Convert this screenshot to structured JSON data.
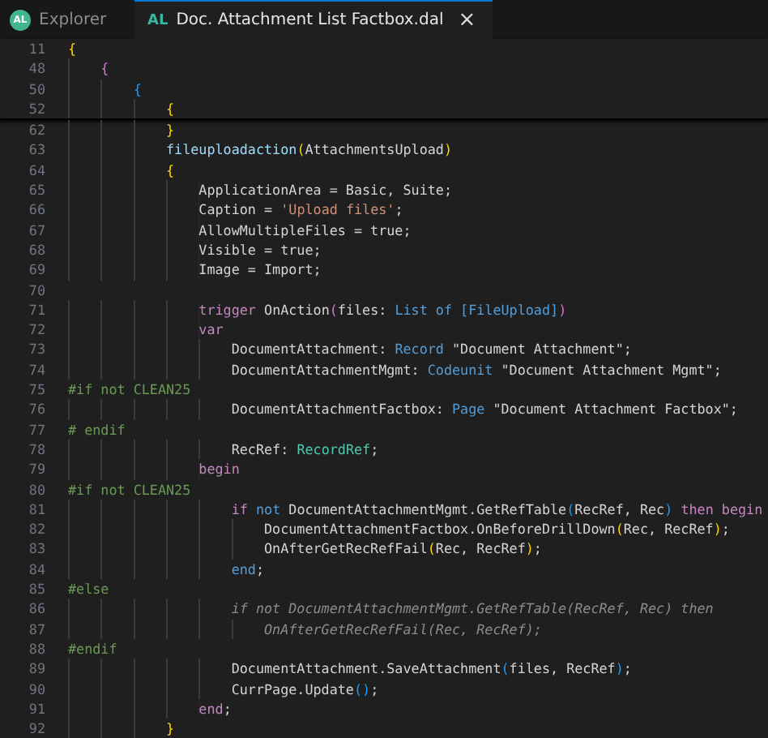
{
  "tabs": [
    {
      "label": "Explorer",
      "badge": "AL",
      "kind": "avatar",
      "selected": false,
      "closable": false
    },
    {
      "label": "Doc. Attachment List Factbox.dal",
      "badge": "AL",
      "kind": "file",
      "selected": true,
      "closable": true,
      "close_glyph": "×"
    }
  ],
  "sticky_lines": [
    {
      "number": "11",
      "tokens": [
        {
          "text": "{",
          "kind": "b1"
        }
      ]
    },
    {
      "number": "48",
      "tokens": [
        {
          "text": "    {",
          "kind": "b2"
        }
      ]
    },
    {
      "number": "50",
      "tokens": [
        {
          "text": "        {",
          "kind": "b3"
        }
      ]
    },
    {
      "number": "52",
      "tokens": [
        {
          "text": "            {",
          "kind": "b1"
        }
      ]
    }
  ],
  "lines": [
    {
      "number": "62",
      "tokens": [
        {
          "text": "            }",
          "kind": "b1"
        }
      ]
    },
    {
      "number": "63",
      "tokens": [
        {
          "text": "            fileuploadaction",
          "kind": "fn"
        },
        {
          "text": "(",
          "kind": "b1"
        },
        {
          "text": "AttachmentsUpload",
          "kind": "plain"
        },
        {
          "text": ")",
          "kind": "b1"
        }
      ]
    },
    {
      "number": "64",
      "tokens": [
        {
          "text": "            {",
          "kind": "b1"
        }
      ]
    },
    {
      "number": "65",
      "tokens": [
        {
          "text": "                ApplicationArea = Basic, Suite;",
          "kind": "plain"
        }
      ]
    },
    {
      "number": "66",
      "tokens": [
        {
          "text": "                Caption = ",
          "kind": "plain"
        },
        {
          "text": "'Upload files'",
          "kind": "string"
        },
        {
          "text": ";",
          "kind": "plain"
        }
      ]
    },
    {
      "number": "67",
      "tokens": [
        {
          "text": "                AllowMultipleFiles = true;",
          "kind": "plain"
        }
      ]
    },
    {
      "number": "68",
      "tokens": [
        {
          "text": "                Visible = true;",
          "kind": "plain"
        }
      ]
    },
    {
      "number": "69",
      "tokens": [
        {
          "text": "                Image = Import;",
          "kind": "plain"
        }
      ]
    },
    {
      "number": "70"
    },
    {
      "number": "71",
      "tokens": [
        {
          "text": "                trigger",
          "kind": "control"
        },
        {
          "text": " OnAction",
          "kind": "plain"
        },
        {
          "text": "(",
          "kind": "b2"
        },
        {
          "text": "files: ",
          "kind": "plain"
        },
        {
          "text": "List of [FileUpload]",
          "kind": "type"
        },
        {
          "text": ")",
          "kind": "b2"
        }
      ]
    },
    {
      "number": "72",
      "tokens": [
        {
          "text": "                var",
          "kind": "control"
        }
      ]
    },
    {
      "number": "73",
      "tokens": [
        {
          "text": "                    DocumentAttachment: ",
          "kind": "plain"
        },
        {
          "text": "Record",
          "kind": "type"
        },
        {
          "text": " \"Document Attachment\";",
          "kind": "plain"
        }
      ]
    },
    {
      "number": "74",
      "tokens": [
        {
          "text": "                    DocumentAttachmentMgmt: ",
          "kind": "plain"
        },
        {
          "text": "Codeunit",
          "kind": "type"
        },
        {
          "text": " \"Document Attachment Mgmt\";",
          "kind": "plain"
        }
      ]
    },
    {
      "number": "75",
      "tokens": [
        {
          "text": "#if not CLEAN25",
          "kind": "directive"
        }
      ]
    },
    {
      "number": "76",
      "tokens": [
        {
          "text": "                    DocumentAttachmentFactbox: ",
          "kind": "plain"
        },
        {
          "text": "Page",
          "kind": "type"
        },
        {
          "text": " \"Document Attachment Factbox\";",
          "kind": "plain"
        }
      ]
    },
    {
      "number": "77",
      "tokens": [
        {
          "text": "# endif",
          "kind": "directive"
        }
      ]
    },
    {
      "number": "78",
      "tokens": [
        {
          "text": "                    RecRef: ",
          "kind": "plain"
        },
        {
          "text": "RecordRef",
          "kind": "class"
        },
        {
          "text": ";",
          "kind": "plain"
        }
      ]
    },
    {
      "number": "79",
      "tokens": [
        {
          "text": "                begin",
          "kind": "control"
        }
      ]
    },
    {
      "number": "80",
      "tokens": [
        {
          "text": "#if not CLEAN25",
          "kind": "directive"
        }
      ]
    },
    {
      "number": "81",
      "tokens": [
        {
          "text": "                    if",
          "kind": "control"
        },
        {
          "text": " not",
          "kind": "type"
        },
        {
          "text": " DocumentAttachmentMgmt.GetRefTable",
          "kind": "plain"
        },
        {
          "text": "(",
          "kind": "b3"
        },
        {
          "text": "RecRef, Rec",
          "kind": "plain"
        },
        {
          "text": ")",
          "kind": "b3"
        },
        {
          "text": " then begin",
          "kind": "control"
        }
      ]
    },
    {
      "number": "82",
      "tokens": [
        {
          "text": "                        DocumentAttachmentFactbox.OnBeforeDrillDown",
          "kind": "plain"
        },
        {
          "text": "(",
          "kind": "b1"
        },
        {
          "text": "Rec, RecRef",
          "kind": "plain"
        },
        {
          "text": ")",
          "kind": "b1"
        },
        {
          "text": ";",
          "kind": "plain"
        }
      ]
    },
    {
      "number": "83",
      "tokens": [
        {
          "text": "                        OnAfterGetRecRefFail",
          "kind": "plain"
        },
        {
          "text": "(",
          "kind": "b1"
        },
        {
          "text": "Rec, RecRef",
          "kind": "plain"
        },
        {
          "text": ")",
          "kind": "b1"
        },
        {
          "text": ";",
          "kind": "plain"
        }
      ]
    },
    {
      "number": "84",
      "tokens": [
        {
          "text": "                    end",
          "kind": "type"
        },
        {
          "text": ";",
          "kind": "plain"
        }
      ]
    },
    {
      "number": "85",
      "tokens": [
        {
          "text": "#else",
          "kind": "directive"
        }
      ]
    },
    {
      "number": "86",
      "tokens": [
        {
          "text": "                    if not DocumentAttachmentMgmt.GetRefTable(RecRef, Rec) then",
          "kind": "inactive"
        }
      ]
    },
    {
      "number": "87",
      "tokens": [
        {
          "text": "                        OnAfterGetRecRefFail(Rec, RecRef);",
          "kind": "inactive"
        }
      ]
    },
    {
      "number": "88",
      "tokens": [
        {
          "text": "#endif",
          "kind": "directive"
        }
      ]
    },
    {
      "number": "89",
      "tokens": [
        {
          "text": "                    DocumentAttachment.SaveAttachment",
          "kind": "plain"
        },
        {
          "text": "(",
          "kind": "b3"
        },
        {
          "text": "files, RecRef",
          "kind": "plain"
        },
        {
          "text": ")",
          "kind": "b3"
        },
        {
          "text": ";",
          "kind": "plain"
        }
      ]
    },
    {
      "number": "90",
      "tokens": [
        {
          "text": "                    CurrPage.Update",
          "kind": "plain"
        },
        {
          "text": "()",
          "kind": "b3"
        },
        {
          "text": ";",
          "kind": "plain"
        }
      ]
    },
    {
      "number": "91",
      "tokens": [
        {
          "text": "                end",
          "kind": "control"
        },
        {
          "text": ";",
          "kind": "plain"
        }
      ]
    },
    {
      "number": "92",
      "tokens": [
        {
          "text": "            }",
          "kind": "b1"
        }
      ]
    }
  ]
}
